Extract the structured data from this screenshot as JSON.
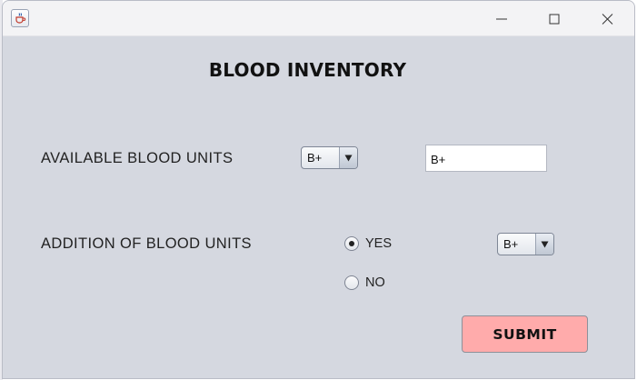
{
  "window": {
    "controls": {
      "minimize_icon": "minimize-icon",
      "maximize_icon": "maximize-icon",
      "close_icon": "close-icon"
    },
    "app_icon": "java-cup-icon"
  },
  "form": {
    "heading": "BLOOD INVENTORY",
    "available": {
      "label": "AVAILABLE BLOOD UNITS",
      "selected_group": "B+",
      "display_value": "B+"
    },
    "addition": {
      "label": "ADDITION OF BLOOD UNITS",
      "options": [
        {
          "label": "YES",
          "checked": true
        },
        {
          "label": "NO",
          "checked": false
        }
      ],
      "selected_group": "B+"
    },
    "submit_label": "SUBMIT"
  },
  "colors": {
    "window_bg": "#d5d8e0",
    "submit_bg": "#ffabab",
    "titlebar_bg": "#f3f3f5"
  }
}
